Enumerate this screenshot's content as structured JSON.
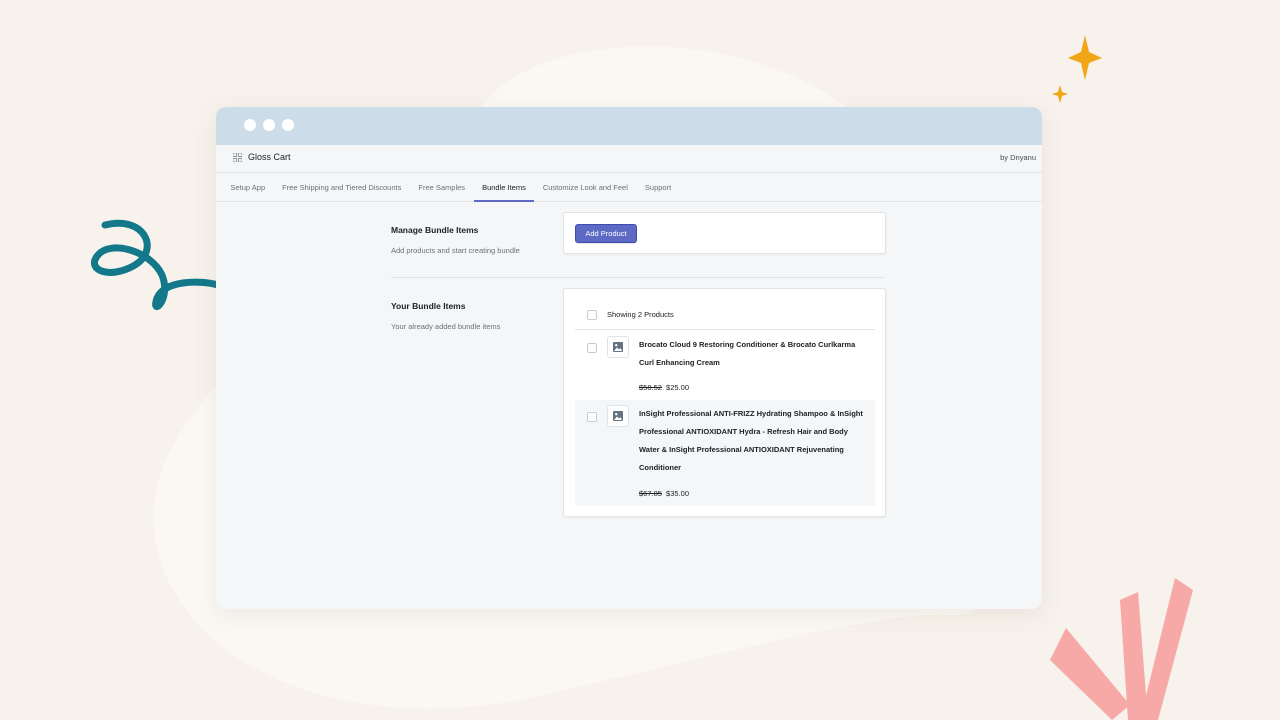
{
  "window": {
    "app_name": "Gloss Cart",
    "by_label": "by Dnyanu"
  },
  "tabs": [
    {
      "label": "Setup App",
      "active": false
    },
    {
      "label": "Free Shipping and Tiered Discounts",
      "active": false
    },
    {
      "label": "Free Samples",
      "active": false
    },
    {
      "label": "Bundle Items",
      "active": true
    },
    {
      "label": "Customize Look and Feel",
      "active": false
    },
    {
      "label": "Support",
      "active": false
    }
  ],
  "manage": {
    "title": "Manage Bundle Items",
    "description": "Add products and start creating bundle",
    "add_button": "Add Product"
  },
  "bundle": {
    "title": "Your Bundle Items",
    "description": "Your already added bundle items",
    "showing": "Showing 2 Products",
    "items": [
      {
        "title": "Brocato Cloud 9 Restoring Conditioner & Brocato Curlkarma Curl Enhancing Cream",
        "compare_price": "$58.52",
        "price": "$25.00"
      },
      {
        "title": "InSight Professional ANTI-FRIZZ Hydrating Shampoo & InSight Professional ANTIOXIDANT Hydra - Refresh Hair and Body Water & InSight Professional ANTIOXIDANT Rejuvenating Conditioner",
        "compare_price": "$67.85",
        "price": "$35.00"
      }
    ]
  },
  "colors": {
    "background": "#f7f2ec",
    "titlebar": "#ccdce9",
    "accent": "#5c6ac4",
    "swirl": "#13788a",
    "sparkle": "#f2a516",
    "rays": "#f7a9a8"
  },
  "icons": [
    "grid-icon",
    "image-placeholder-icon",
    "sparkle-icon",
    "swirl-decoration",
    "ray-decoration"
  ]
}
